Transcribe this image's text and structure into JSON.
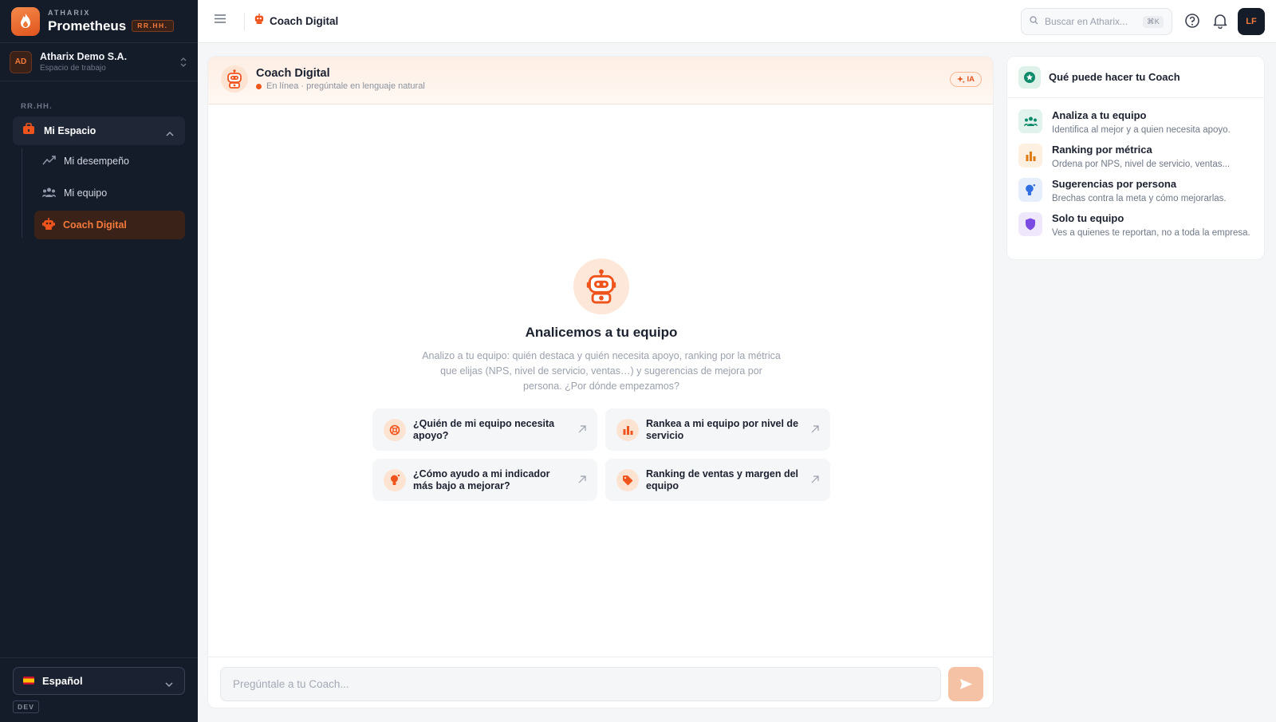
{
  "brand": {
    "company": "ATHARIX",
    "product": "Prometheus",
    "badge": "RR.HH."
  },
  "workspace": {
    "avatar": "AD",
    "name": "Atharix Demo S.A.",
    "subtitle": "Espacio de trabajo"
  },
  "sidebar": {
    "section_label": "RR.HH.",
    "group": {
      "label": "Mi Espacio",
      "icon": "briefcase-icon"
    },
    "items": [
      {
        "label": "Mi desempeño",
        "icon": "trend-icon",
        "active": false
      },
      {
        "label": "Mi equipo",
        "icon": "team-icon",
        "active": false
      },
      {
        "label": "Coach Digital",
        "icon": "robot-icon",
        "active": true
      }
    ]
  },
  "language": {
    "label": "Español",
    "flag": "spain-flag-icon"
  },
  "env_badge": "DEV",
  "topbar": {
    "breadcrumb": "Coach Digital",
    "search_placeholder": "Buscar en Atharix...",
    "search_shortcut": "⌘K",
    "user_initials": "LF"
  },
  "chat": {
    "title": "Coach Digital",
    "status": "En línea · pregúntale en lenguaje natural",
    "ai_badge": "IA",
    "empty_title": "Analicemos a tu equipo",
    "empty_description": "Analizo a tu equipo: quién destaca y quién necesita apoyo, ranking por la métrica que elijas (NPS, nivel de servicio, ventas…) y sugerencias de mejora por persona. ¿Por dónde empezamos?",
    "suggestions": [
      {
        "text": "¿Quién de mi equipo necesita apoyo?",
        "icon": "lifebuoy-icon"
      },
      {
        "text": "Rankea a mi equipo por nivel de servicio",
        "icon": "bar-chart-icon"
      },
      {
        "text": "¿Cómo ayudo a mi indicador más bajo a mejorar?",
        "icon": "lightbulb-icon"
      },
      {
        "text": "Ranking de ventas y margen del equipo",
        "icon": "tag-icon"
      }
    ],
    "input_placeholder": "Pregúntale a tu Coach..."
  },
  "capabilities": {
    "title": "Qué puede hacer tu Coach",
    "items": [
      {
        "title": "Analiza a tu equipo",
        "description": "Identifica al mejor y a quien necesita apoyo.",
        "icon": "team-icon",
        "color": "#0f8a6a"
      },
      {
        "title": "Ranking por métrica",
        "description": "Ordena por NPS, nivel de servicio, ventas...",
        "icon": "bar-chart-icon",
        "color": "#e07a14"
      },
      {
        "title": "Sugerencias por persona",
        "description": "Brechas contra la meta y cómo mejorarlas.",
        "icon": "lightbulb-icon",
        "color": "#2f6fe0"
      },
      {
        "title": "Solo tu equipo",
        "description": "Ves a quienes te reportan, no a toda la empresa.",
        "icon": "shield-icon",
        "color": "#7b4ae0"
      }
    ]
  },
  "colors": {
    "accent": "#f0541d",
    "sidebar_bg": "#141b29"
  }
}
